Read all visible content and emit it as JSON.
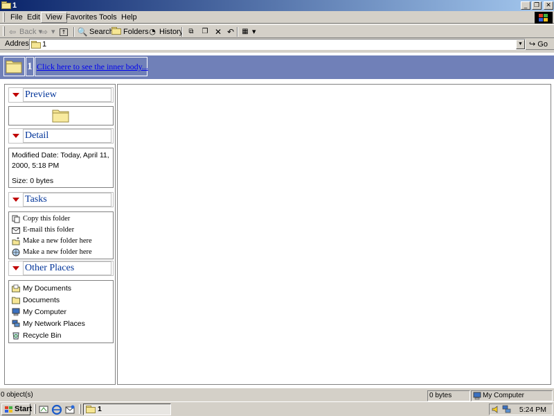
{
  "window": {
    "title": "1",
    "controls": {
      "minimize": "_",
      "restore": "❐",
      "close": "✕"
    }
  },
  "menu": [
    "File",
    "Edit",
    "View",
    "Favorites",
    "Tools",
    "Help"
  ],
  "toolbar": {
    "back": "Back",
    "search": "Search",
    "folders": "Folders",
    "history": "History"
  },
  "address": {
    "label": "Address",
    "value": "1",
    "go": "Go"
  },
  "banner": {
    "folder_name": "1",
    "link": "Click here to see the inner body..."
  },
  "panel": {
    "preview": {
      "title": "Preview"
    },
    "detail": {
      "title": "Detail",
      "modified": "Modified Date: Today, April 11, 2000, 5:18 PM",
      "size": "Size: 0 bytes"
    },
    "tasks": {
      "title": "Tasks",
      "items": [
        "Copy this folder",
        "E-mail this folder",
        "Make a new folder here",
        "Make a new folder here"
      ]
    },
    "other_places": {
      "title": "Other Places",
      "items": [
        "My Documents",
        "Documents",
        "My Computer",
        "My Network Places",
        "Recycle Bin"
      ]
    }
  },
  "status": {
    "objects": "0 object(s)",
    "size": "0 bytes",
    "zone": "My Computer"
  },
  "taskbar": {
    "start": "Start",
    "window_button": "1",
    "clock": "5:24 PM"
  },
  "colors": {
    "title_gradient_start": "#0a246a",
    "title_gradient_end": "#a6caf0",
    "banner": "#7080b8",
    "section_title": "#003399",
    "triangle": "#c00000",
    "link": "#0000ee"
  },
  "icons": [
    "folder-icon",
    "back-arrow-icon",
    "forward-arrow-icon",
    "up-folder-icon",
    "search-icon",
    "folders-icon",
    "history-icon",
    "move-to-icon",
    "copy-to-icon",
    "delete-icon",
    "undo-icon",
    "views-icon",
    "go-arrow-icon",
    "windows-logo-icon"
  ]
}
